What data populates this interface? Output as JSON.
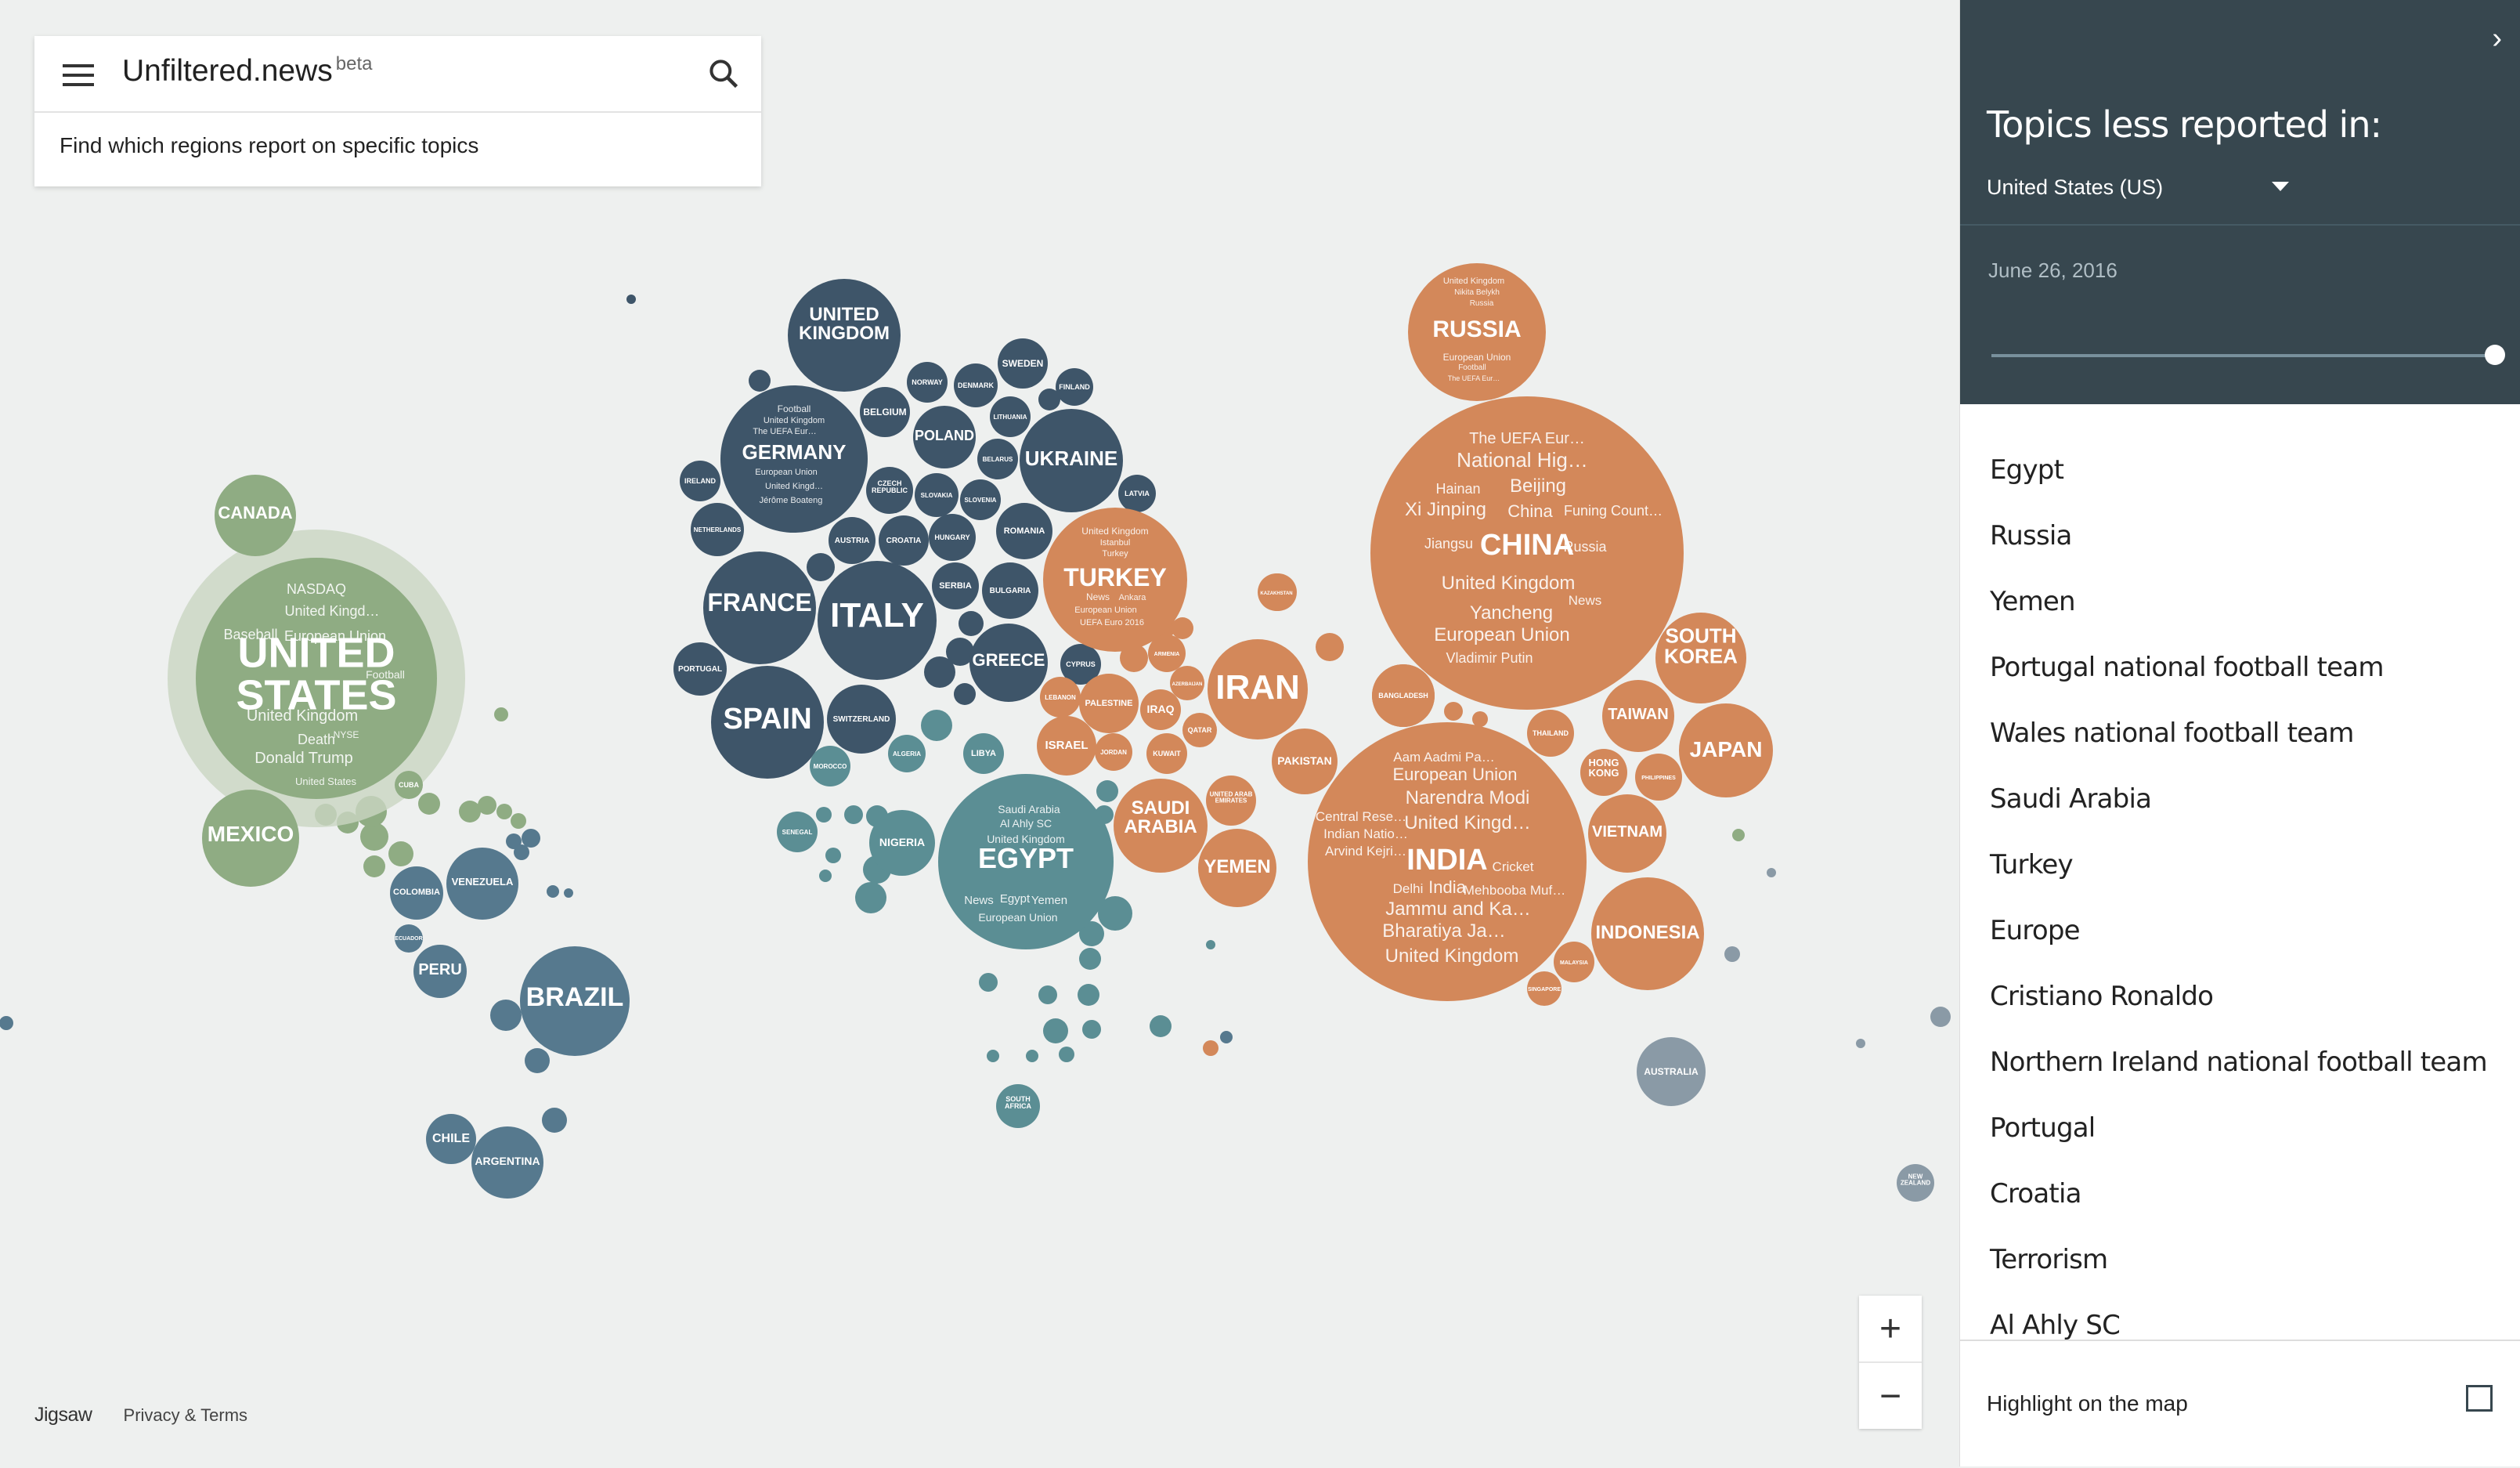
{
  "app": {
    "title": "Unfiltered.news",
    "beta": "beta",
    "tagline": "Find which regions report on specific topics"
  },
  "footer": {
    "logo": "Jigsaw",
    "link": "Privacy & Terms"
  },
  "zoom": {
    "in": "+",
    "out": "−"
  },
  "panel": {
    "chevron": "›",
    "title": "Topics less reported in:",
    "country": "United States (US)",
    "date": "June 26, 2016",
    "slider_value": 1.0,
    "topics": [
      "Egypt",
      "Russia",
      "Yemen",
      "Portugal national football team",
      "Wales national football team",
      "Saudi Arabia",
      "Turkey",
      "Europe",
      "Cristiano Ronaldo",
      "Northern Ireland national football team",
      "Portugal",
      "Croatia",
      "Terrorism",
      "Al Ahly SC"
    ],
    "highlight_label": "Highlight on the map",
    "highlight_checked": false
  },
  "colors": {
    "americas": "#8fac83",
    "south_america": "#56798e",
    "europe": "#3e5569",
    "africa": "#5b8e94",
    "asia": "#d3885a",
    "oceania": "#8a9aa6",
    "panel": "#37474f"
  },
  "bubbles": [
    {
      "name": "UNITED STATES",
      "topics": [
        "NASDAQ",
        "United Kingd…",
        "Baseball",
        "European Union",
        "Football",
        "United Kingdom",
        "Death",
        "NYSE",
        "Donald Trump",
        "United States"
      ]
    },
    {
      "name": "CANADA"
    },
    {
      "name": "MEXICO"
    },
    {
      "name": "CUBA"
    },
    {
      "name": "COLOMBIA"
    },
    {
      "name": "VENEZUELA"
    },
    {
      "name": "ECUADOR"
    },
    {
      "name": "PERU"
    },
    {
      "name": "BRAZIL"
    },
    {
      "name": "CHILE"
    },
    {
      "name": "ARGENTINA"
    },
    {
      "name": "UNITED KINGDOM"
    },
    {
      "name": "GERMANY",
      "topics": [
        "Football",
        "United Kingdom",
        "The UEFA Eur…",
        "European Union",
        "United Kingd…",
        "Jérôme Boateng"
      ]
    },
    {
      "name": "FRANCE"
    },
    {
      "name": "ITALY"
    },
    {
      "name": "SPAIN"
    },
    {
      "name": "UKRAINE"
    },
    {
      "name": "POLAND"
    },
    {
      "name": "GREECE"
    },
    {
      "name": "BELGIUM"
    },
    {
      "name": "SWEDEN"
    },
    {
      "name": "NORWAY"
    },
    {
      "name": "DENMARK"
    },
    {
      "name": "FINLAND"
    },
    {
      "name": "LITHUANIA"
    },
    {
      "name": "BELARUS"
    },
    {
      "name": "LATVIA"
    },
    {
      "name": "IRELAND"
    },
    {
      "name": "NETHERLANDS"
    },
    {
      "name": "CZECH REPUBLIC"
    },
    {
      "name": "SLOVAKIA"
    },
    {
      "name": "SLOVENIA"
    },
    {
      "name": "AUSTRIA"
    },
    {
      "name": "CROATIA"
    },
    {
      "name": "HUNGARY"
    },
    {
      "name": "ROMANIA"
    },
    {
      "name": "SERBIA"
    },
    {
      "name": "BULGARIA"
    },
    {
      "name": "PORTUGAL"
    },
    {
      "name": "SWITZERLAND"
    },
    {
      "name": "CYPRUS"
    },
    {
      "name": "TURKEY",
      "topics": [
        "United Kingdom",
        "Istanbul",
        "Turkey",
        "News",
        "Ankara",
        "European Union",
        "UEFA Euro 2016"
      ]
    },
    {
      "name": "RUSSIA",
      "topics": [
        "United Kingdom",
        "Nikita Belykh",
        "Russia",
        "European Union",
        "Football",
        "The UEFA Eur…"
      ]
    },
    {
      "name": "EGYPT",
      "topics": [
        "Saudi Arabia",
        "Al Ahly SC",
        "United Kingdom",
        "News",
        "Egypt",
        "Yemen",
        "European Union"
      ]
    },
    {
      "name": "LIBYA"
    },
    {
      "name": "ALGERIA"
    },
    {
      "name": "MOROCCO"
    },
    {
      "name": "SENEGAL"
    },
    {
      "name": "NIGERIA"
    },
    {
      "name": "SOUTH AFRICA"
    },
    {
      "name": "IRAN"
    },
    {
      "name": "SAUDI ARABIA"
    },
    {
      "name": "YEMEN"
    },
    {
      "name": "ISRAEL"
    },
    {
      "name": "PALESTINE"
    },
    {
      "name": "LEBANON"
    },
    {
      "name": "IRAQ"
    },
    {
      "name": "JORDAN"
    },
    {
      "name": "KUWAIT"
    },
    {
      "name": "QATAR"
    },
    {
      "name": "ARMENIA"
    },
    {
      "name": "AZERBAIJAN"
    },
    {
      "name": "UNITED ARAB EMIRATES"
    },
    {
      "name": "PAKISTAN"
    },
    {
      "name": "KAZAKHSTAN"
    },
    {
      "name": "BANGLADESH"
    },
    {
      "name": "CHINA",
      "topics": [
        "The UEFA Eur…",
        "National Hig…",
        "Hainan",
        "Beijing",
        "Xi Jinping",
        "China",
        "Funing Count…",
        "Jiangsu",
        "Russia",
        "United Kingdom",
        "News",
        "Yancheng",
        "European Union",
        "Vladimir Putin"
      ]
    },
    {
      "name": "INDIA",
      "topics": [
        "Aam Aadmi Pa…",
        "European Union",
        "Narendra Modi",
        "Central Rese…",
        "United Kingd…",
        "Indian Natio…",
        "Arvind Kejri…",
        "Cricket",
        "Delhi",
        "India",
        "Mehbooba Muf…",
        "Jammu and Ka…",
        "Bharatiya Ja…",
        "United Kingdom"
      ]
    },
    {
      "name": "SOUTH KOREA"
    },
    {
      "name": "JAPAN"
    },
    {
      "name": "TAIWAN"
    },
    {
      "name": "HONG KONG"
    },
    {
      "name": "THAILAND"
    },
    {
      "name": "PHILIPPINES"
    },
    {
      "name": "VIETNAM"
    },
    {
      "name": "INDONESIA"
    },
    {
      "name": "MALAYSIA"
    },
    {
      "name": "SINGAPORE"
    },
    {
      "name": "AUSTRALIA"
    },
    {
      "name": "NEW ZEALAND"
    }
  ]
}
